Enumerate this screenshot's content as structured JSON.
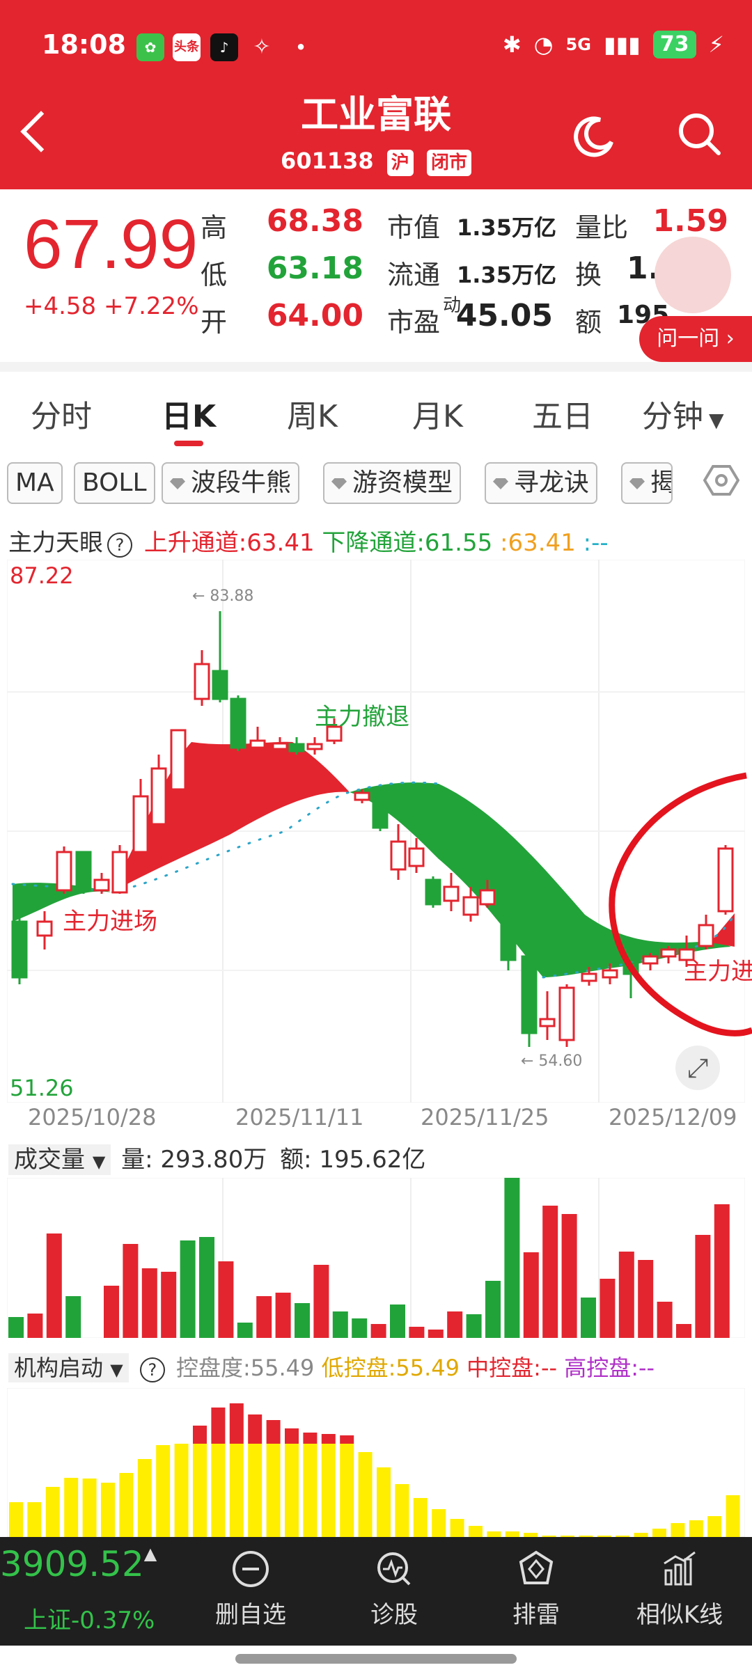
{
  "status_bar": {
    "time": "18:08",
    "apps": [
      "头条"
    ],
    "network": "5G",
    "battery": "73"
  },
  "header": {
    "title": "工业富联",
    "code": "601138",
    "exchange_tag": "沪",
    "status_tag": "闭市"
  },
  "quote": {
    "price": "67.99",
    "change": "+4.58 +7.22%",
    "high_label": "高",
    "high": "68.38",
    "low_label": "低",
    "low": "63.18",
    "open_label": "开",
    "open": "64.00",
    "mcap_label": "市值",
    "mcap": "1.35万亿",
    "float_label": "流通",
    "float": "1.35万亿",
    "pe_label": "市盈",
    "pe_sup": "动",
    "pe": "45.05",
    "vr_label": "量比",
    "vr": "1.59",
    "turnover_label": "换",
    "turnover": "1.4",
    "amount_label": "额",
    "amount": "195",
    "ask_button": "问一问 ›"
  },
  "tabs": [
    "分时",
    "日K",
    "周K",
    "月K",
    "五日",
    "分钟"
  ],
  "indicator_chips": [
    "MA",
    "BOLL",
    "波段牛熊",
    "游资模型",
    "寻龙诀",
    "揭"
  ],
  "main_indicator": {
    "name": "主力天眼",
    "up_channel": "上升通道:63.41",
    "down_channel": "下降通道:61.55",
    "value": ":63.41",
    "dash": ":--"
  },
  "kline": {
    "y_max": "87.22",
    "y_min": "51.26",
    "high_marker": "← 83.88",
    "low_marker": "← 54.60",
    "annotation_exit": "主力撤退",
    "annotation_enter": "主力进场",
    "annotation_enter_right": "主力进",
    "dates": [
      "2025/10/28",
      "2025/11/11",
      "2025/11/25",
      "2025/12/09"
    ]
  },
  "volume": {
    "name": "成交量",
    "vol": "量: 293.80万",
    "amount": "额: 195.62亿"
  },
  "inst": {
    "name": "机构启动",
    "control": "控盘度:55.49",
    "low_ctrl": "低控盘:55.49",
    "mid_ctrl": "中控盘:--",
    "high_ctrl": "高控盘:--"
  },
  "bottom_bar": {
    "index_value": "3909.52",
    "index_change": "上证-0.37%",
    "items": [
      "删自选",
      "诊股",
      "排雷",
      "相似K线"
    ]
  },
  "colors": {
    "brand_red": "#e3252f",
    "green": "#22a33a",
    "yellow": "#ffee00"
  }
}
